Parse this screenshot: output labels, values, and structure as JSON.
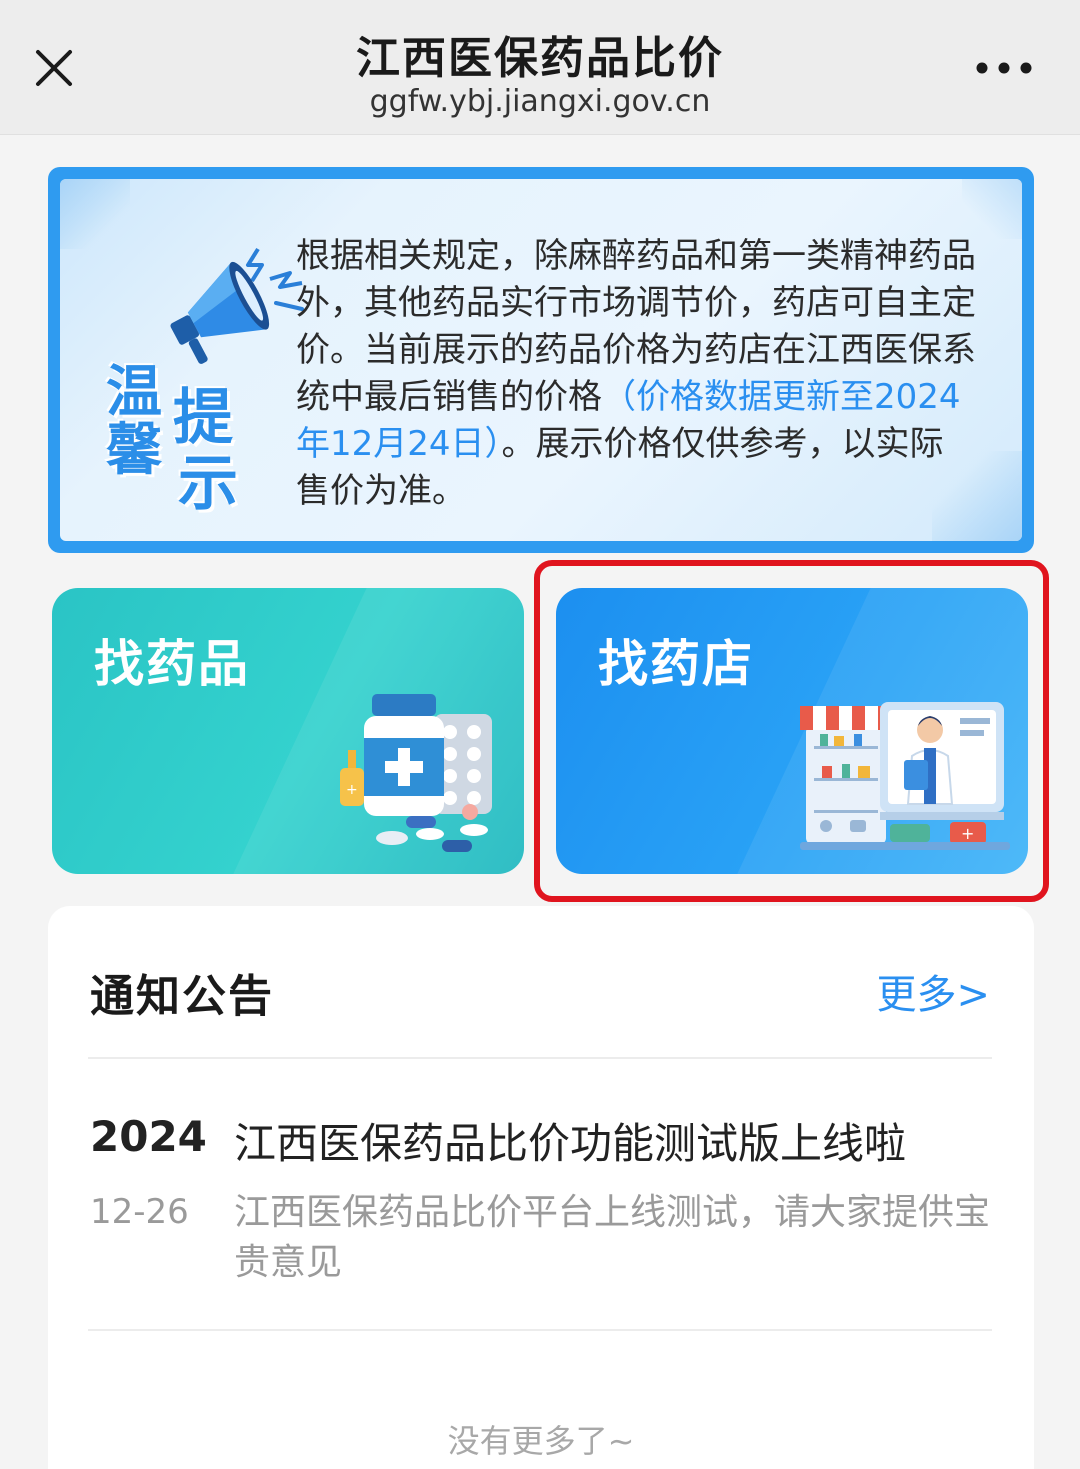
{
  "navbar": {
    "title": "江西医保药品比价",
    "url": "ggfw.ybj.jiangxi.gov.cn",
    "close_icon": "close-icon",
    "more_icon": "more-dots-icon"
  },
  "notice": {
    "badge_chars": [
      "温",
      "提",
      "馨",
      "示"
    ],
    "text_part1": "根据相关规定，除麻醉药品和第一类精神药品外，其他药品实行市场调节价，药店可自主定价。当前展示的药品价格为药店在江西医保系统中最后销售的价格",
    "text_highlight": "（价格数据更新至2024年12月24日）",
    "text_part2": "。展示价格仅供参考，以实际售价为准。",
    "icon": "megaphone-icon"
  },
  "cards": {
    "find_drug": "找药品",
    "find_store": "找药店"
  },
  "colors": {
    "accent_blue": "#2a8ff0",
    "teal_card": "#2ac4c5",
    "blue_card": "#1c8ff0",
    "highlight_red": "#e0141e"
  },
  "announcements": {
    "title": "通知公告",
    "more": "更多>",
    "items": [
      {
        "year": "2024",
        "date": "12-26",
        "title": "江西医保药品比价功能测试版上线啦",
        "desc": "江西医保药品比价平台上线测试，请大家提供宝贵意见"
      }
    ],
    "end_text": "没有更多了~"
  }
}
